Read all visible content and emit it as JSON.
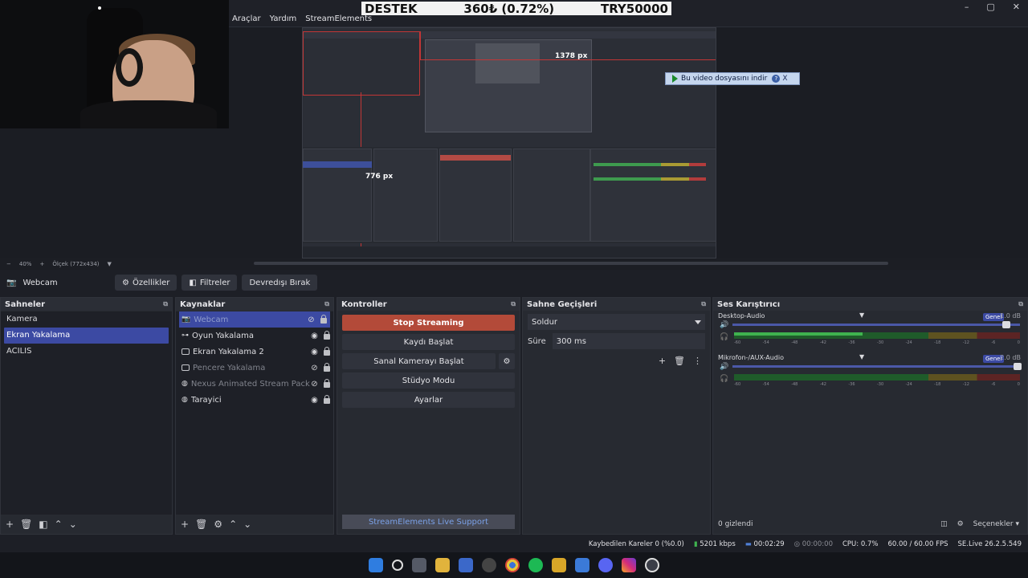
{
  "menu": [
    "Araçlar",
    "Yardım",
    "StreamElements"
  ],
  "ticker": {
    "left": "DESTEK",
    "mid": "360₺ (0.72%)",
    "right": "TRY50000"
  },
  "window_controls": [
    "–",
    "▢",
    "✕"
  ],
  "preview": {
    "px_width": "1378 px",
    "px_height": "776 px",
    "download_button": "Bu video dosyasını indir",
    "help": "?",
    "close": "X"
  },
  "zoom": {
    "level": "40%",
    "scale": "Ölçek (772x434)"
  },
  "source_toolbar": {
    "source_name": "Webcam",
    "properties": "Özellikler",
    "filters": "Filtreler",
    "deactivate": "Devredışı Bırak"
  },
  "scenes": {
    "title": "Sahneler",
    "items": [
      {
        "label": "Kamera"
      },
      {
        "label": "Ekran Yakalama"
      },
      {
        "label": "ACILIS"
      }
    ]
  },
  "sources": {
    "title": "Kaynaklar",
    "items": [
      {
        "label": "Webcam"
      },
      {
        "label": "Oyun Yakalama"
      },
      {
        "label": "Ekran Yakalama 2"
      },
      {
        "label": "Pencere Yakalama"
      },
      {
        "label": "Nexus Animated Stream Package -"
      },
      {
        "label": "Tarayici"
      }
    ]
  },
  "controls": {
    "title": "Kontroller",
    "stop_streaming": "Stop Streaming",
    "record": "Kaydı Başlat",
    "virtual_cam": "Sanal Kamerayı Başlat",
    "studio_mode": "Stüdyo Modu",
    "settings": "Ayarlar",
    "live_support": "StreamElements Live Support"
  },
  "transitions": {
    "title": "Sahne Geçişleri",
    "selected": "Soldur",
    "duration_label": "Süre",
    "duration_value": "300 ms"
  },
  "mixer": {
    "title": "Ses Karıştırıcı",
    "channels": [
      {
        "name": "Desktop-Audio",
        "badge": "Genel",
        "db": "-1.0 dB",
        "volume": 0.95,
        "level": 0.45
      },
      {
        "name": "Mikrofon-/AUX-Audio",
        "badge": "Genel",
        "db": "2.0 dB",
        "volume": 0.99,
        "level": 0.0
      }
    ],
    "ticks": [
      "-60",
      "-54",
      "-48",
      "-42",
      "-36",
      "-30",
      "-24",
      "-18",
      "-12",
      "-6",
      "0"
    ],
    "hidden": "0 gizlendi",
    "options": "Seçenekler"
  },
  "status": {
    "dropped": "Kaybedilen Kareler 0 (%0.0)",
    "bitrate": "5201 kbps",
    "stream_time": "00:02:29",
    "rec_time": "00:00:00",
    "cpu": "CPU: 0.7%",
    "fps": "60.00 / 60.00 FPS",
    "version": "SE.Live 26.2.5.549"
  },
  "colors": {
    "accent": "#3c4aa3",
    "stop": "#b34a39",
    "panel": "#272a31"
  }
}
